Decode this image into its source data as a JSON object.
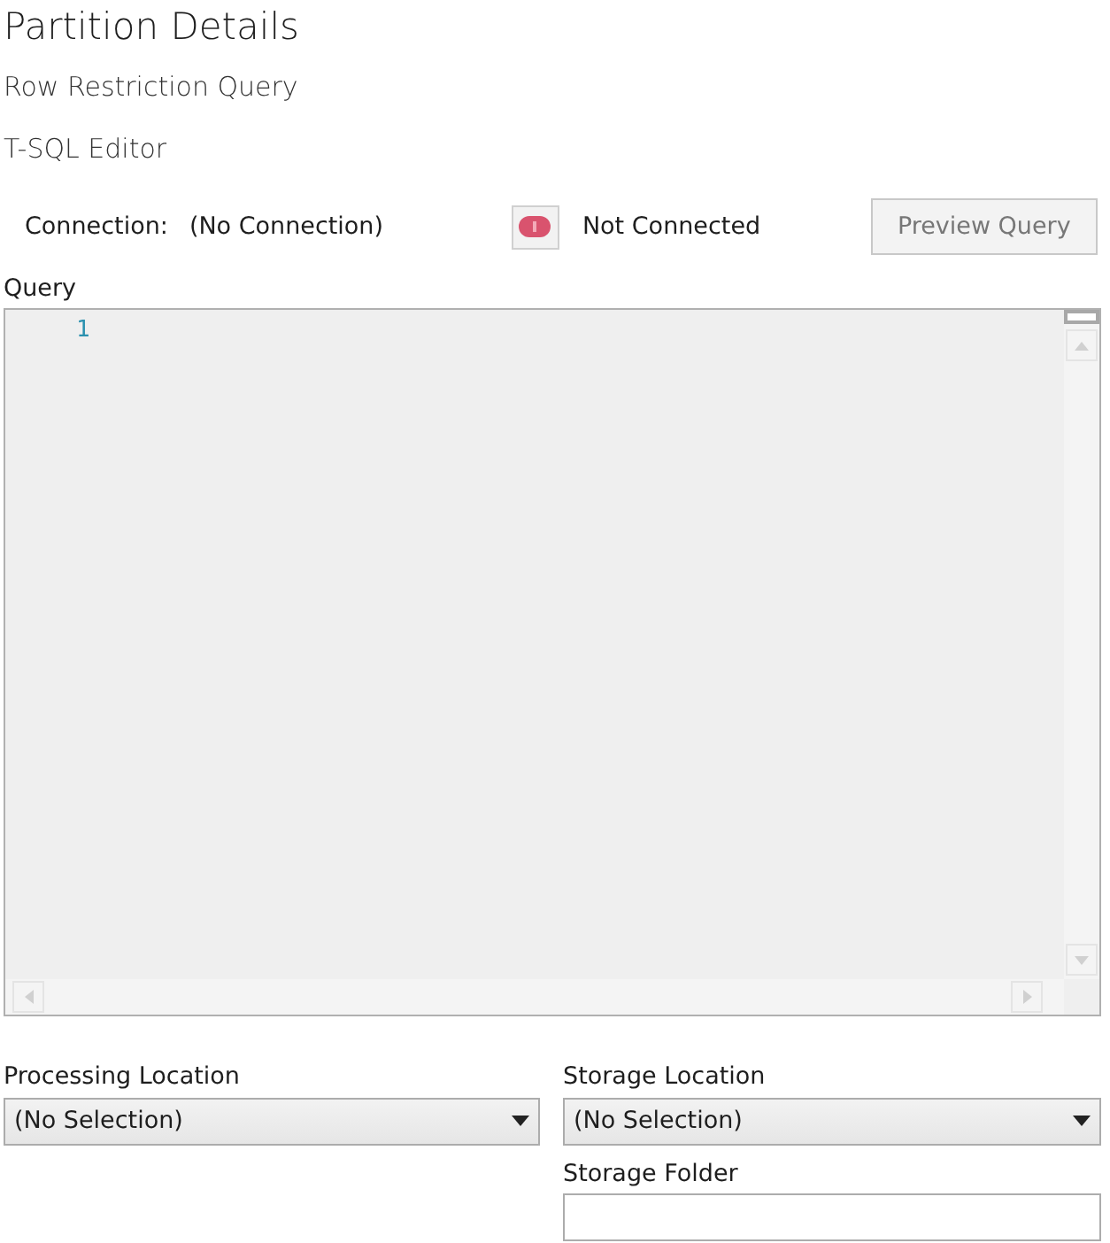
{
  "title": "Partition Details",
  "subtitle": "Row Restriction Query",
  "editor_heading": "T-SQL Editor",
  "connection": {
    "label": "Connection:",
    "value": "(No Connection)",
    "connected": false,
    "status": "Not Connected"
  },
  "preview_button": {
    "label": "Preview Query",
    "disabled": true
  },
  "query": {
    "label": "Query",
    "line_numbers": [
      "1"
    ]
  },
  "fields": [
    {
      "kind": "dropdown",
      "label": "Processing Location",
      "value": "(No Selection)"
    },
    {
      "kind": "dropdown",
      "label": "Storage Location",
      "value": "(No Selection)"
    },
    {
      "kind": "spacer"
    },
    {
      "kind": "text",
      "label": "Storage Folder"
    }
  ]
}
